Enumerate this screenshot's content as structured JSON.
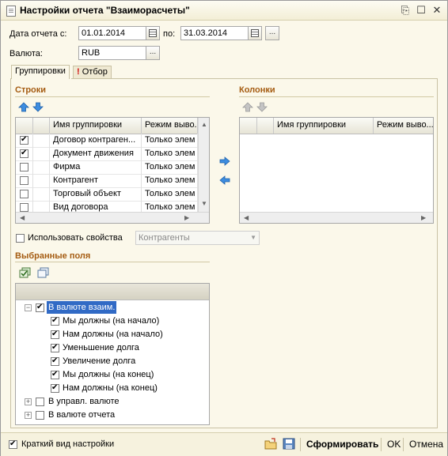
{
  "window": {
    "title": "Настройки отчета \"Взаиморасчеты\""
  },
  "period": {
    "date_from_label": "Дата отчета с:",
    "date_from_value": "01.01.2014",
    "date_to_label": "по:",
    "date_to_value": "31.03.2014",
    "more_button": "..."
  },
  "currency": {
    "label": "Валюта:",
    "value": "RUB",
    "select_button": "..."
  },
  "tabs": [
    {
      "label": "Группировки",
      "active": true
    },
    {
      "label": "Отбор",
      "active": false,
      "icon": "exclamation-icon"
    }
  ],
  "rows_section": {
    "title": "Строки",
    "columns": [
      "Имя группировки",
      "Режим выво..."
    ],
    "items": [
      {
        "checked": true,
        "name": "Договор контраген...",
        "mode": "Только элем"
      },
      {
        "checked": true,
        "name": "Документ движения",
        "mode": "Только элем"
      },
      {
        "checked": false,
        "name": "Фирма",
        "mode": "Только элем"
      },
      {
        "checked": false,
        "name": "Контрагент",
        "mode": "Только элем"
      },
      {
        "checked": false,
        "name": "Торговый объект",
        "mode": "Только элем"
      },
      {
        "checked": false,
        "name": "Вид договора",
        "mode": "Только элем"
      }
    ]
  },
  "columns_section": {
    "title": "Колонки",
    "columns": [
      "Имя группировки",
      "Режим выво..."
    ],
    "items": []
  },
  "use_properties": {
    "label": "Использовать свойства",
    "checked": false,
    "combo_value": "Контрагенты"
  },
  "selected_fields": {
    "title": "Выбранные поля",
    "tree": [
      {
        "label": "В валюте взаим.",
        "checked": true,
        "expanded": true,
        "selected": true,
        "children": [
          {
            "label": "Мы должны (на начало)",
            "checked": true
          },
          {
            "label": "Нам должны (на начало)",
            "checked": true
          },
          {
            "label": "Уменьшение долга",
            "checked": true
          },
          {
            "label": "Увеличение долга",
            "checked": true
          },
          {
            "label": "Мы должны (на конец)",
            "checked": true
          },
          {
            "label": "Нам должны (на конец)",
            "checked": true
          }
        ]
      },
      {
        "label": "В управл. валюте",
        "checked": false,
        "expanded": false
      },
      {
        "label": "В валюте отчета",
        "checked": false,
        "expanded": false
      }
    ]
  },
  "bottom": {
    "short_view_label": "Краткий вид настройки",
    "short_view_checked": true,
    "generate_label": "Сформировать",
    "ok_label": "OK",
    "cancel_label": "Отмена"
  },
  "colors": {
    "window_bg": "#fbf8ea",
    "section_title": "#a55c12",
    "selection": "#316ac5",
    "arrow_blue": "#3d8de0"
  }
}
